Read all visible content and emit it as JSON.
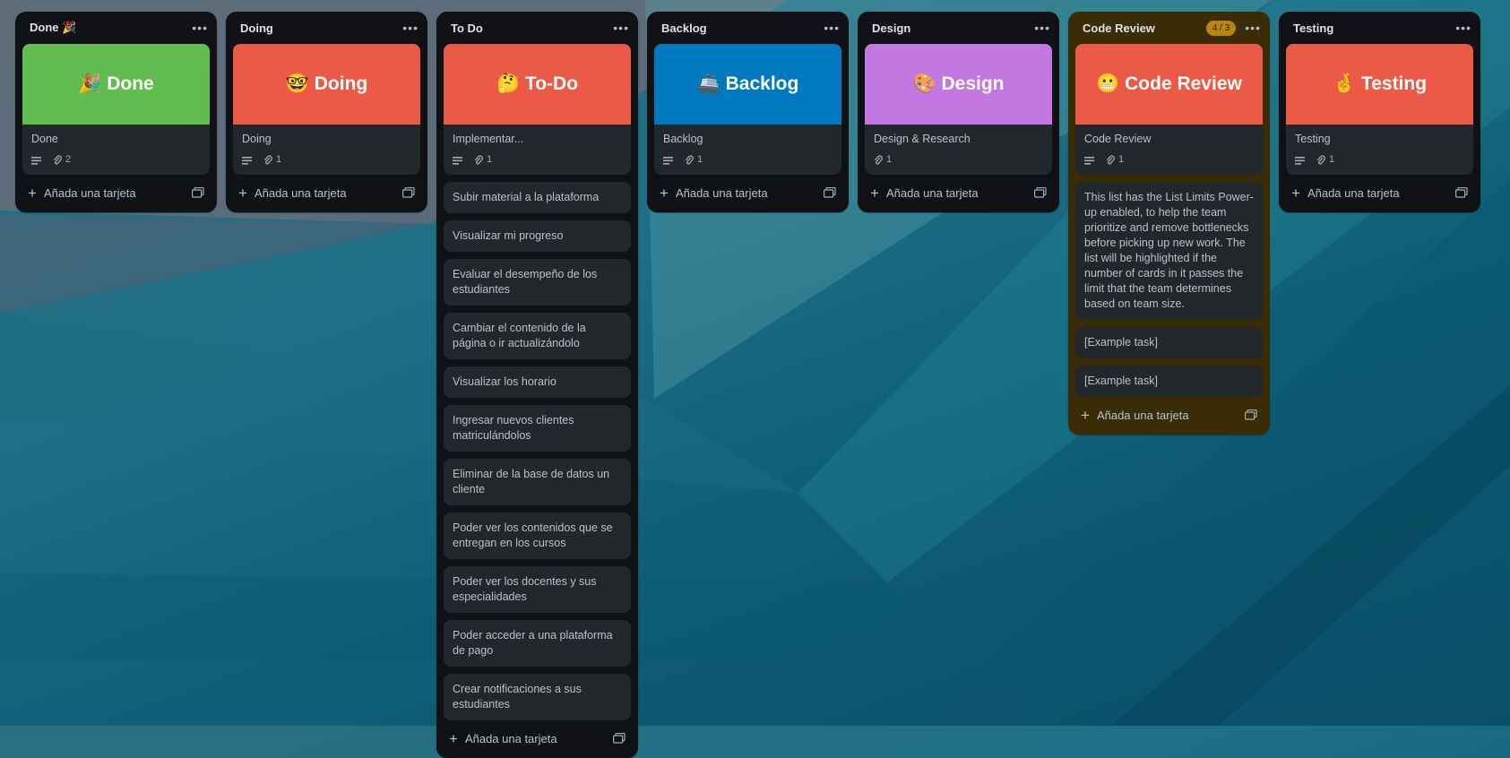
{
  "lists": {
    "done": {
      "title": "Done 🎉",
      "cover_text": "🎉 Done",
      "card_title": "Done",
      "attachments": "2",
      "add_label": "Añada una tarjeta"
    },
    "doing": {
      "title": "Doing",
      "cover_text": "🤓 Doing",
      "card_title": "Doing",
      "attachments": "1",
      "add_label": "Añada una tarjeta"
    },
    "todo": {
      "title": "To Do",
      "cover_text": "🤔 To-Do",
      "card_title": "Implementar...",
      "attachments": "1",
      "cards": [
        "Subir material a la plataforma",
        "Visualizar mi progreso",
        "Evaluar el desempeño de los estudiantes",
        "Cambiar el contenido de la página o ir actualizándolo",
        "Visualizar los horario",
        "Ingresar nuevos clientes matriculándolos",
        "Eliminar de la base de datos un cliente",
        "Poder ver los contenidos que se entregan en los cursos",
        "Poder ver los docentes y sus especialidades",
        "Poder acceder a una plataforma de pago",
        "Crear notificaciones a sus estudiantes"
      ],
      "add_label": "Añada una tarjeta"
    },
    "backlog": {
      "title": "Backlog",
      "cover_text": "🚢 Backlog",
      "card_title": "Backlog",
      "attachments": "1",
      "add_label": "Añada una tarjeta"
    },
    "design": {
      "title": "Design",
      "cover_text": "🎨 Design",
      "card_title": "Design & Research",
      "attachments": "1",
      "add_label": "Añada una tarjeta"
    },
    "review": {
      "title": "Code Review",
      "limit_badge": "4 / 3",
      "cover_text": "😬 Code Review",
      "card_title": "Code Review",
      "attachments": "1",
      "info_text": "This list has the List Limits Power-up enabled, to help the team prioritize and remove bottlenecks before picking up new work. The list will be highlighted if the number of cards in it passes the limit that the team determines based on team size.",
      "cards": [
        "[Example task]",
        "[Example task]"
      ],
      "add_label": "Añada una tarjeta"
    },
    "testing": {
      "title": "Testing",
      "cover_text": "🤞 Testing",
      "card_title": "Testing",
      "attachments": "1",
      "add_label": "Añada una tarjeta"
    }
  },
  "colors": {
    "done": "#61bd4f",
    "doing": "#eb5a46",
    "todo": "#eb5a46",
    "backlog": "#0079bf",
    "design": "#c377e0",
    "review": "#eb5a46",
    "testing": "#eb5a46"
  },
  "icons": {
    "description": "description-icon",
    "attachment": "paperclip-icon",
    "menu": "more-dots-icon",
    "add": "plus-icon",
    "template": "card-template-icon"
  }
}
